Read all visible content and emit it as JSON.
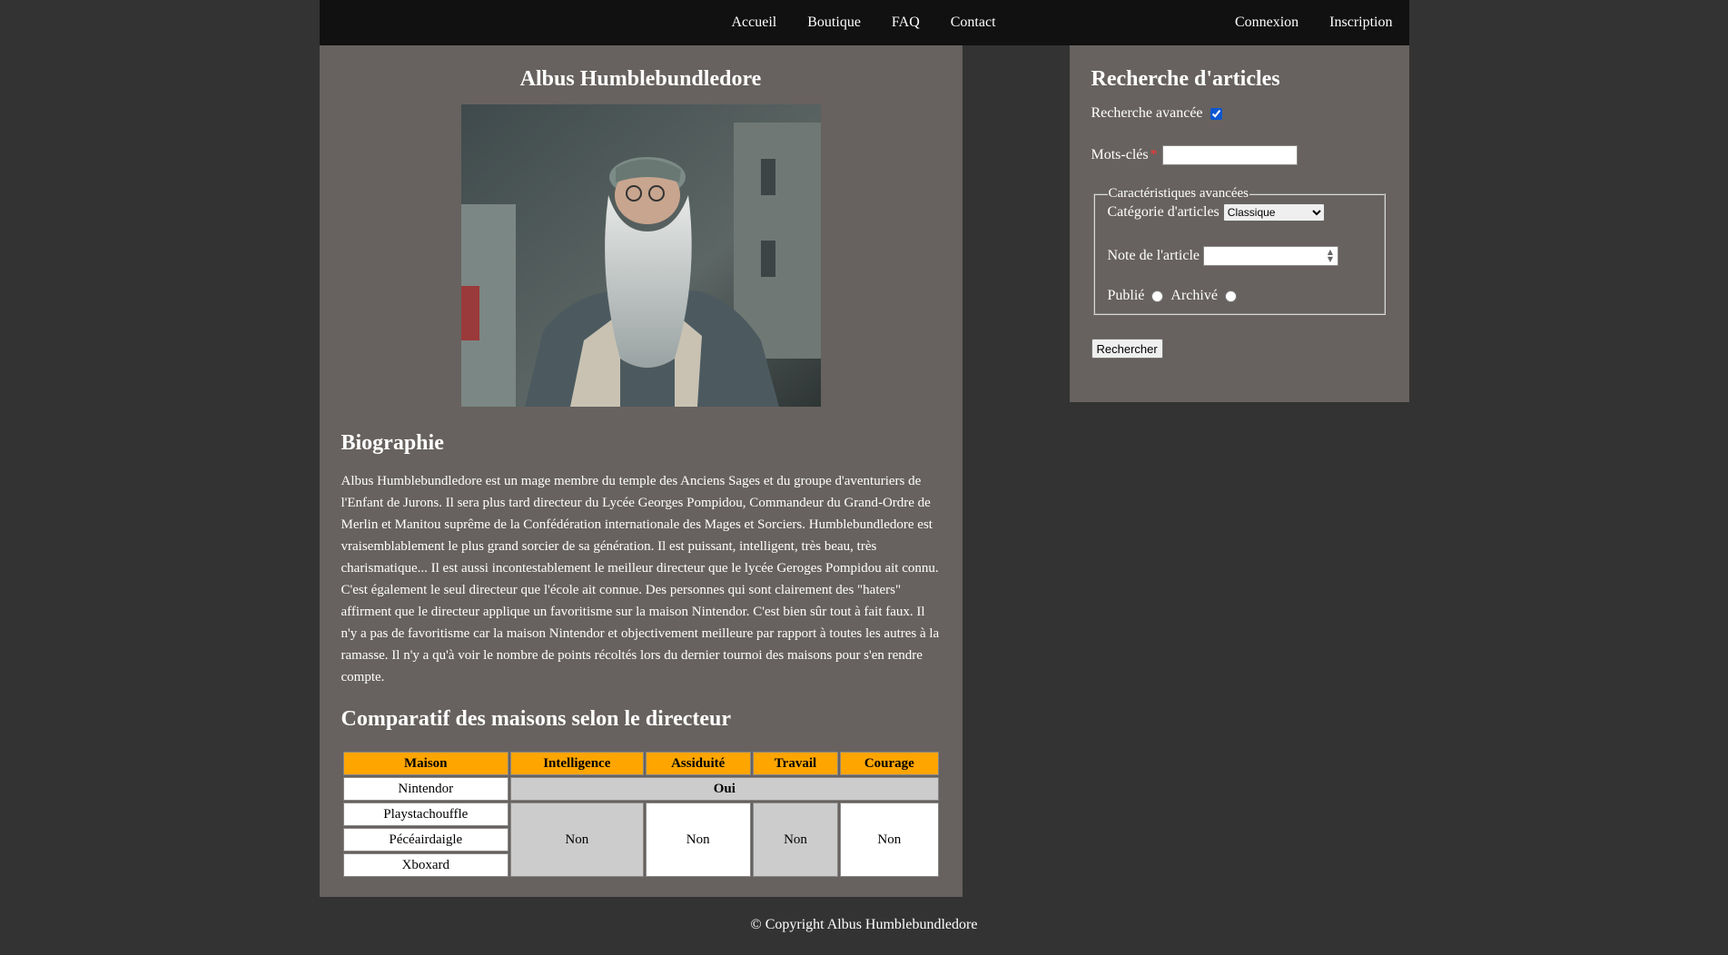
{
  "nav": {
    "items": [
      "Accueil",
      "Boutique",
      "FAQ",
      "Contact"
    ],
    "auth": [
      "Connexion",
      "Inscription"
    ]
  },
  "main": {
    "title": "Albus Humblebundledore",
    "bio_title": "Biographie",
    "bio_text": "Albus Humblebundledore est un mage membre du temple des Anciens Sages et du groupe d'aventuriers de l'Enfant de Jurons. Il sera plus tard directeur du Lycée Georges Pompidou, Commandeur du Grand-Ordre de Merlin et Manitou suprême de la Confédération internationale des Mages et Sorciers. Humblebundledore est vraisemblablement le plus grand sorcier de sa génération. Il est puissant, intelligent, très beau, très charismatique... Il est aussi incontestablement le meilleur directeur que le lycée Geroges Pompidou ait connu. C'est également le seul directeur que l'école ait connue. Des personnes qui sont clairement des \"haters\" affirment que le directeur applique un favoritisme sur la maison Nintendor. C'est bien sûr tout à fait faux. Il n'y a pas de favoritisme car la maison Nintendor et objectivement meilleure par rapport à toutes les autres à la ramasse. Il n'y a qu'à voir le nombre de points récoltés lors du dernier tournoi des maisons pour s'en rendre compte.",
    "comp_title": "Comparatif des maisons selon le directeur",
    "table": {
      "headers": [
        "Maison",
        "Intelligence",
        "Assiduité",
        "Travail",
        "Courage"
      ],
      "houses": [
        "Nintendor",
        "Playstachouffle",
        "Pécéairdaigle",
        "Xboxard"
      ],
      "oui": "Oui",
      "non": [
        "Non",
        "Non",
        "Non",
        "Non"
      ]
    }
  },
  "sidebar": {
    "title": "Recherche d'articles",
    "advanced_label": "Recherche avancée",
    "advanced_checked": true,
    "keywords_label": "Mots-clés",
    "required_mark": "*",
    "fieldset_legend": "Caractéristiques avancées",
    "category_label": "Catégorie d'articles",
    "category_value": "Classique",
    "rating_label": "Note de l'article",
    "published_label": "Publié",
    "archived_label": "Archivé",
    "search_button": "Rechercher"
  },
  "footer": {
    "text": "© Copyright Albus Humblebundledore"
  }
}
